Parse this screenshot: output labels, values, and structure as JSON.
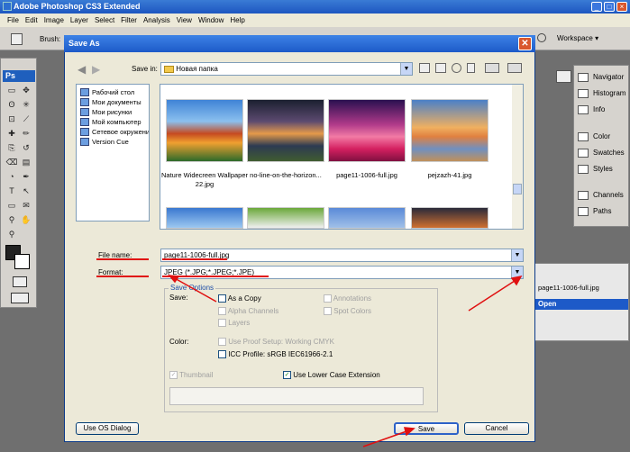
{
  "app": {
    "title": "Adobe Photoshop CS3 Extended",
    "logo": "Ps"
  },
  "menu": [
    "File",
    "Edit",
    "Image",
    "Layer",
    "Select",
    "Filter",
    "Analysis",
    "View",
    "Window",
    "Help"
  ],
  "options_bar": {
    "brush_label": "Brush:",
    "workspace_label": "Workspace ▾"
  },
  "panels": {
    "items": [
      {
        "label": "Navigator",
        "icon": "navigator-icon"
      },
      {
        "label": "Histogram",
        "icon": "histogram-icon"
      },
      {
        "label": "Info",
        "icon": "info-icon"
      },
      {
        "label": "Color",
        "icon": "color-icon"
      },
      {
        "label": "Swatches",
        "icon": "swatches-icon"
      },
      {
        "label": "Styles",
        "icon": "styles-icon"
      },
      {
        "label": "Channels",
        "icon": "channels-icon"
      },
      {
        "label": "Paths",
        "icon": "paths-icon"
      }
    ]
  },
  "history": {
    "filename": "page11-1006-full.jpg",
    "state": "Open"
  },
  "dialog": {
    "title": "Save As",
    "save_in_label": "Save in:",
    "save_in_value": "Новая папка",
    "places": [
      "Рабочий стол",
      "Мои документы",
      "Мои рисунки",
      "Мой компьютер",
      "Сетевое окружение",
      "Version Cue"
    ],
    "files": [
      {
        "name": "Nature Widecreen Wallpaper 22.jpg"
      },
      {
        "name": "no-line-on-the-horizon..."
      },
      {
        "name": "page11-1006-full.jpg"
      },
      {
        "name": "pejzazh-41.jpg"
      }
    ],
    "file_name_label": "File name:",
    "file_name_value": "page11-1006-full.jpg",
    "format_label": "Format:",
    "format_value": "JPEG (*.JPG;*.JPEG;*.JPE)",
    "save_options_title": "Save Options",
    "save_label": "Save:",
    "as_a_copy": "As a Copy",
    "annotations": "Annotations",
    "alpha_channels": "Alpha Channels",
    "spot_colors": "Spot Colors",
    "layers": "Layers",
    "color_label": "Color:",
    "use_proof_setup": "Use Proof Setup:  Working CMYK",
    "icc_profile": "ICC Profile:  sRGB IEC61966-2.1",
    "thumbnail": "Thumbnail",
    "lower_case": "Use Lower Case Extension",
    "use_os_dialog": "Use OS Dialog",
    "save_button": "Save",
    "cancel_button": "Cancel"
  },
  "colors": {
    "accent": "#1d5ac8",
    "annotation": "#e01010"
  }
}
